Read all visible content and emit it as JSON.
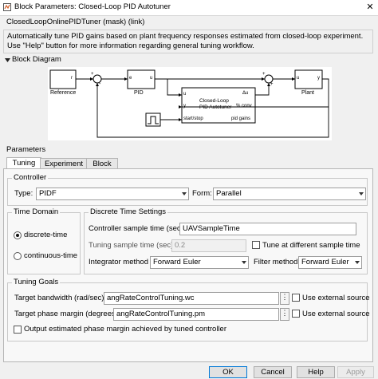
{
  "window": {
    "title": "Block Parameters: Closed-Loop PID Autotuner",
    "close_glyph": "✕"
  },
  "subtitle": "ClosedLoopOnlinePIDTuner (mask) (link)",
  "description": "Automatically tune PID gains based on plant frequency responses estimated from closed-loop experiment. Use \"Help\" button for more information regarding general tuning workflow.",
  "block_diagram": {
    "header": "Block Diagram",
    "reference_label": "Reference",
    "pid_label": "PID",
    "plant_label": "Plant",
    "autotuner_title_1": "Closed-Loop",
    "autotuner_title_2": "PID Autotuner",
    "port_r": "r",
    "port_e": "e",
    "port_u_pid": "u",
    "port_u_in": "u",
    "port_y_in": "y",
    "port_start": "start/stop",
    "port_du": "Δu",
    "port_pconv": "% conv",
    "port_gains": "pid gains",
    "port_u_plant": "u",
    "port_y_plant": "y",
    "sum_plus": "+",
    "sum_minus": "-"
  },
  "parameters": {
    "header": "Parameters",
    "tabs": [
      "Tuning",
      "Experiment",
      "Block"
    ],
    "active_tab": "Tuning"
  },
  "controller": {
    "group_label": "Controller",
    "type_label": "Type:",
    "type_value": "PIDF",
    "form_label": "Form:",
    "form_value": "Parallel"
  },
  "time_domain": {
    "group_label": "Time Domain",
    "option_discrete": "discrete-time",
    "option_continuous": "continuous-time",
    "selected": "discrete-time"
  },
  "discrete_settings": {
    "group_label": "Discrete Time Settings",
    "controller_sample_label": "Controller sample time (sec)",
    "controller_sample_value": "UAVSampleTime",
    "tuning_sample_label": "Tuning sample time (sec)",
    "tuning_sample_value": "0.2",
    "tune_different_label": "Tune at different sample time",
    "tune_different_checked": false,
    "integrator_label": "Integrator method",
    "integrator_value": "Forward Euler",
    "filter_label": "Filter method",
    "filter_value": "Forward Euler"
  },
  "tuning_goals": {
    "group_label": "Tuning Goals",
    "bandwidth_label": "Target bandwidth (rad/sec)",
    "bandwidth_value": "angRateControlTuning.wc",
    "phase_label": "Target phase margin (degrees)",
    "phase_value": "angRateControlTuning.pm",
    "external_source_label": "Use external source",
    "external_bw_checked": false,
    "external_pm_checked": false,
    "output_pm_label": "Output estimated phase margin achieved by tuned controller",
    "output_pm_checked": false,
    "dots": "⋮"
  },
  "buttons": {
    "ok": "OK",
    "cancel": "Cancel",
    "help": "Help",
    "apply": "Apply"
  },
  "colors": {
    "primary_border": "#0078d7"
  }
}
